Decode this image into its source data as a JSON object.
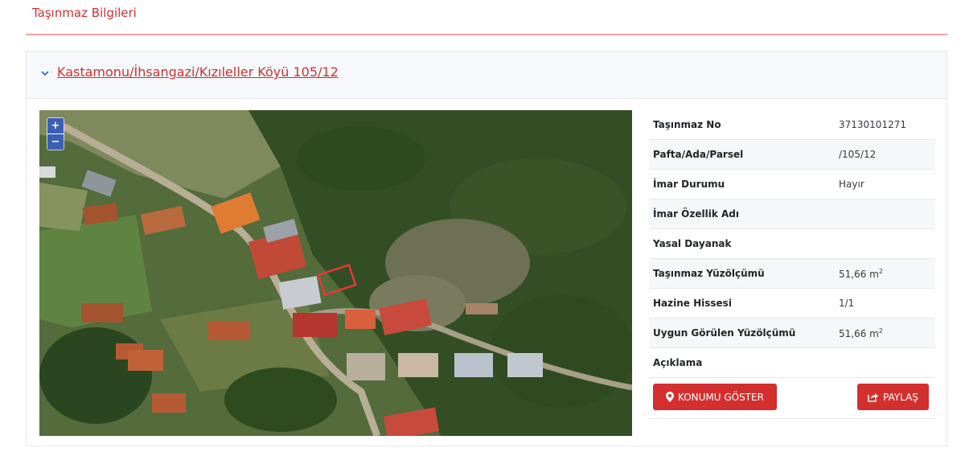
{
  "page": {
    "title": "Taşınmaz Bilgileri"
  },
  "parcel": {
    "link_text": "Kastamonu/İhsangazi/Kızıleller Köyü 105/12"
  },
  "map": {
    "zoom_in": "+",
    "zoom_out": "−"
  },
  "info": {
    "rows": [
      {
        "label": "Taşınmaz No",
        "value": "37130101271"
      },
      {
        "label": "Pafta/Ada/Parsel",
        "value": "/105/12"
      },
      {
        "label": "İmar Durumu",
        "value": "Hayır"
      },
      {
        "label": "İmar Özellik Adı",
        "value": ""
      },
      {
        "label": "Yasal Dayanak",
        "value": ""
      },
      {
        "label": "Taşınmaz Yüzölçümü",
        "value": "51,66 m",
        "unit_sup": "2"
      },
      {
        "label": "Hazine Hissesi",
        "value": "1/1"
      },
      {
        "label": "Uygun Görülen Yüzölçümü",
        "value": "51,66 m",
        "unit_sup": "2"
      },
      {
        "label": "Açıklama",
        "value": ""
      }
    ]
  },
  "actions": {
    "show_location": "KONUMU GÖSTER",
    "share": "PAYLAŞ"
  },
  "icons": {
    "chevron": "chevron-down-icon",
    "location": "map-marker-icon",
    "share": "share-icon"
  },
  "colors": {
    "accent": "#d32f2f",
    "zoom_control": "#3a5fb4",
    "header_bg": "#f6f8fa"
  }
}
